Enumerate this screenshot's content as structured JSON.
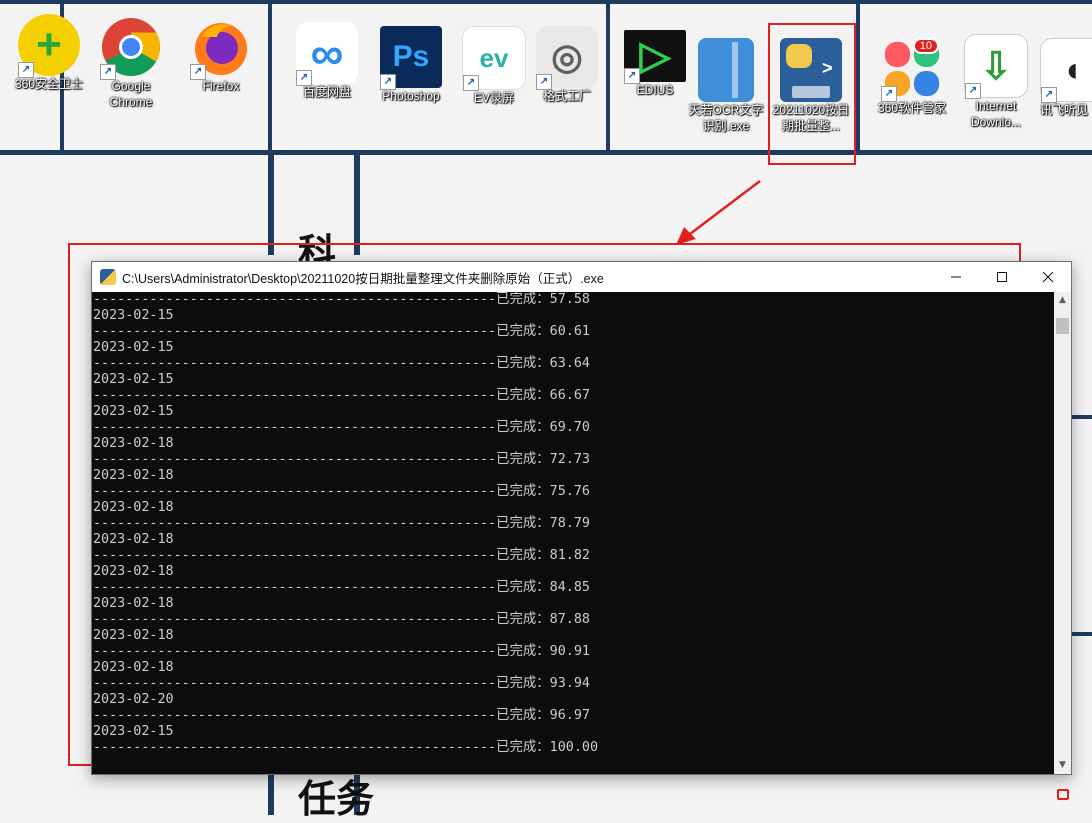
{
  "desktop": {
    "icons": [
      {
        "label": "360安全卫士",
        "glyph": "+",
        "color": "#f5d000",
        "fg": "#2aa43c"
      },
      {
        "label": "Google Chrome",
        "glyph": "",
        "color": "#ffffff",
        "fg": "#db4437"
      },
      {
        "label": "Firefox",
        "glyph": "",
        "color": "#ff7a1a",
        "fg": "#7b2cbf"
      },
      {
        "label": "百度网盘",
        "glyph": "∞",
        "color": "#ffffff",
        "fg": "#2b8cf0"
      },
      {
        "label": "Photoshop",
        "glyph": "Ps",
        "color": "#0a2a5a",
        "fg": "#31a8ff"
      },
      {
        "label": "EV录屏",
        "glyph": "ev",
        "color": "#ffffff",
        "fg": "#2ab3a6"
      },
      {
        "label": "格式工厂",
        "glyph": "◎",
        "color": "#e8e8e8",
        "fg": "#606060"
      },
      {
        "label": "EDIUS",
        "glyph": "▷",
        "color": "#111111",
        "fg": "#2dd04d"
      },
      {
        "label": "天若OCR文字识别.exe",
        "glyph": "",
        "color": "#3f8fd8",
        "fg": "#ffffff"
      },
      {
        "label": "20211020按日期批量整...",
        "glyph": ">",
        "color": "#2c5e9a",
        "fg": "#ffffff"
      },
      {
        "label": "360软件管家",
        "glyph": "",
        "color": "#ffffff",
        "fg": "#ffffff",
        "badge": "10"
      },
      {
        "label": "Internet Downlo...",
        "glyph": "⇩",
        "color": "#ffffff",
        "fg": "#2a9d3a"
      },
      {
        "label": "讯飞听见",
        "glyph": "",
        "color": "#ffffff",
        "fg": "#222222"
      }
    ],
    "wallpaper_glyphs": [
      "科",
      "任务"
    ]
  },
  "console": {
    "title": "C:\\Users\\Administrator\\Desktop\\20211020按日期批量整理文件夹删除原始（正式）.exe",
    "lines": [
      "--------------------------------------------------已完成：57.58",
      "2023-02-15",
      "--------------------------------------------------已完成：60.61",
      "2023-02-15",
      "--------------------------------------------------已完成：63.64",
      "2023-02-15",
      "--------------------------------------------------已完成：66.67",
      "2023-02-15",
      "--------------------------------------------------已完成：69.70",
      "2023-02-18",
      "--------------------------------------------------已完成：72.73",
      "2023-02-18",
      "--------------------------------------------------已完成：75.76",
      "2023-02-18",
      "--------------------------------------------------已完成：78.79",
      "2023-02-18",
      "--------------------------------------------------已完成：81.82",
      "2023-02-18",
      "--------------------------------------------------已完成：84.85",
      "2023-02-18",
      "--------------------------------------------------已完成：87.88",
      "2023-02-18",
      "--------------------------------------------------已完成：90.91",
      "2023-02-18",
      "--------------------------------------------------已完成：93.94",
      "2023-02-20",
      "--------------------------------------------------已完成：96.97",
      "2023-02-15",
      "--------------------------------------------------已完成：100.00"
    ],
    "scroll_position": 0.02
  },
  "colors": {
    "annotation": "#e0201f",
    "console_bg": "#0c0c0c",
    "console_fg": "#cccccc",
    "wallpaper_lines": "#1f3a5f"
  }
}
